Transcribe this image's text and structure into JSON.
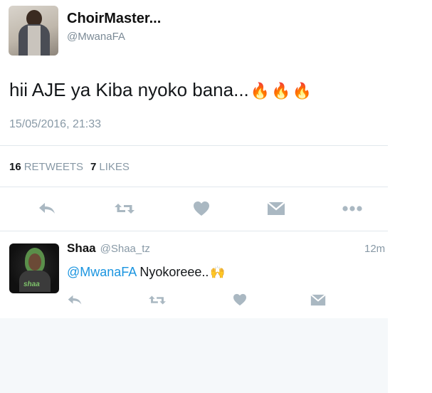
{
  "tweet": {
    "display_name": "ChoirMaster...",
    "handle": "@MwanaFA",
    "text": "hii AJE ya Kiba nyoko bana...",
    "emoji": [
      "🔥",
      "🔥",
      "🔥"
    ],
    "timestamp": "15/05/2016, 21:33",
    "stats": {
      "retweets_count": "16",
      "retweets_label": "RETWEETS",
      "likes_count": "7",
      "likes_label": "LIKES"
    },
    "actions": [
      "reply-icon",
      "retweet-icon",
      "like-icon",
      "message-icon",
      "more-icon"
    ]
  },
  "reply": {
    "display_name": "Shaa",
    "handle": "@Shaa_tz",
    "time": "12m",
    "mention": "@MwanaFA",
    "text": "Nyokoreee..",
    "emoji": "🙌",
    "avatar_logo": "shaa",
    "actions": [
      "reply-icon",
      "retweet-icon",
      "like-icon",
      "message-icon"
    ]
  },
  "colors": {
    "icon": "#aab8c2",
    "mention": "#1b95e0",
    "muted_text": "#8899a6",
    "divider": "#e1e8ed",
    "background_lower": "#f5f8fa"
  }
}
